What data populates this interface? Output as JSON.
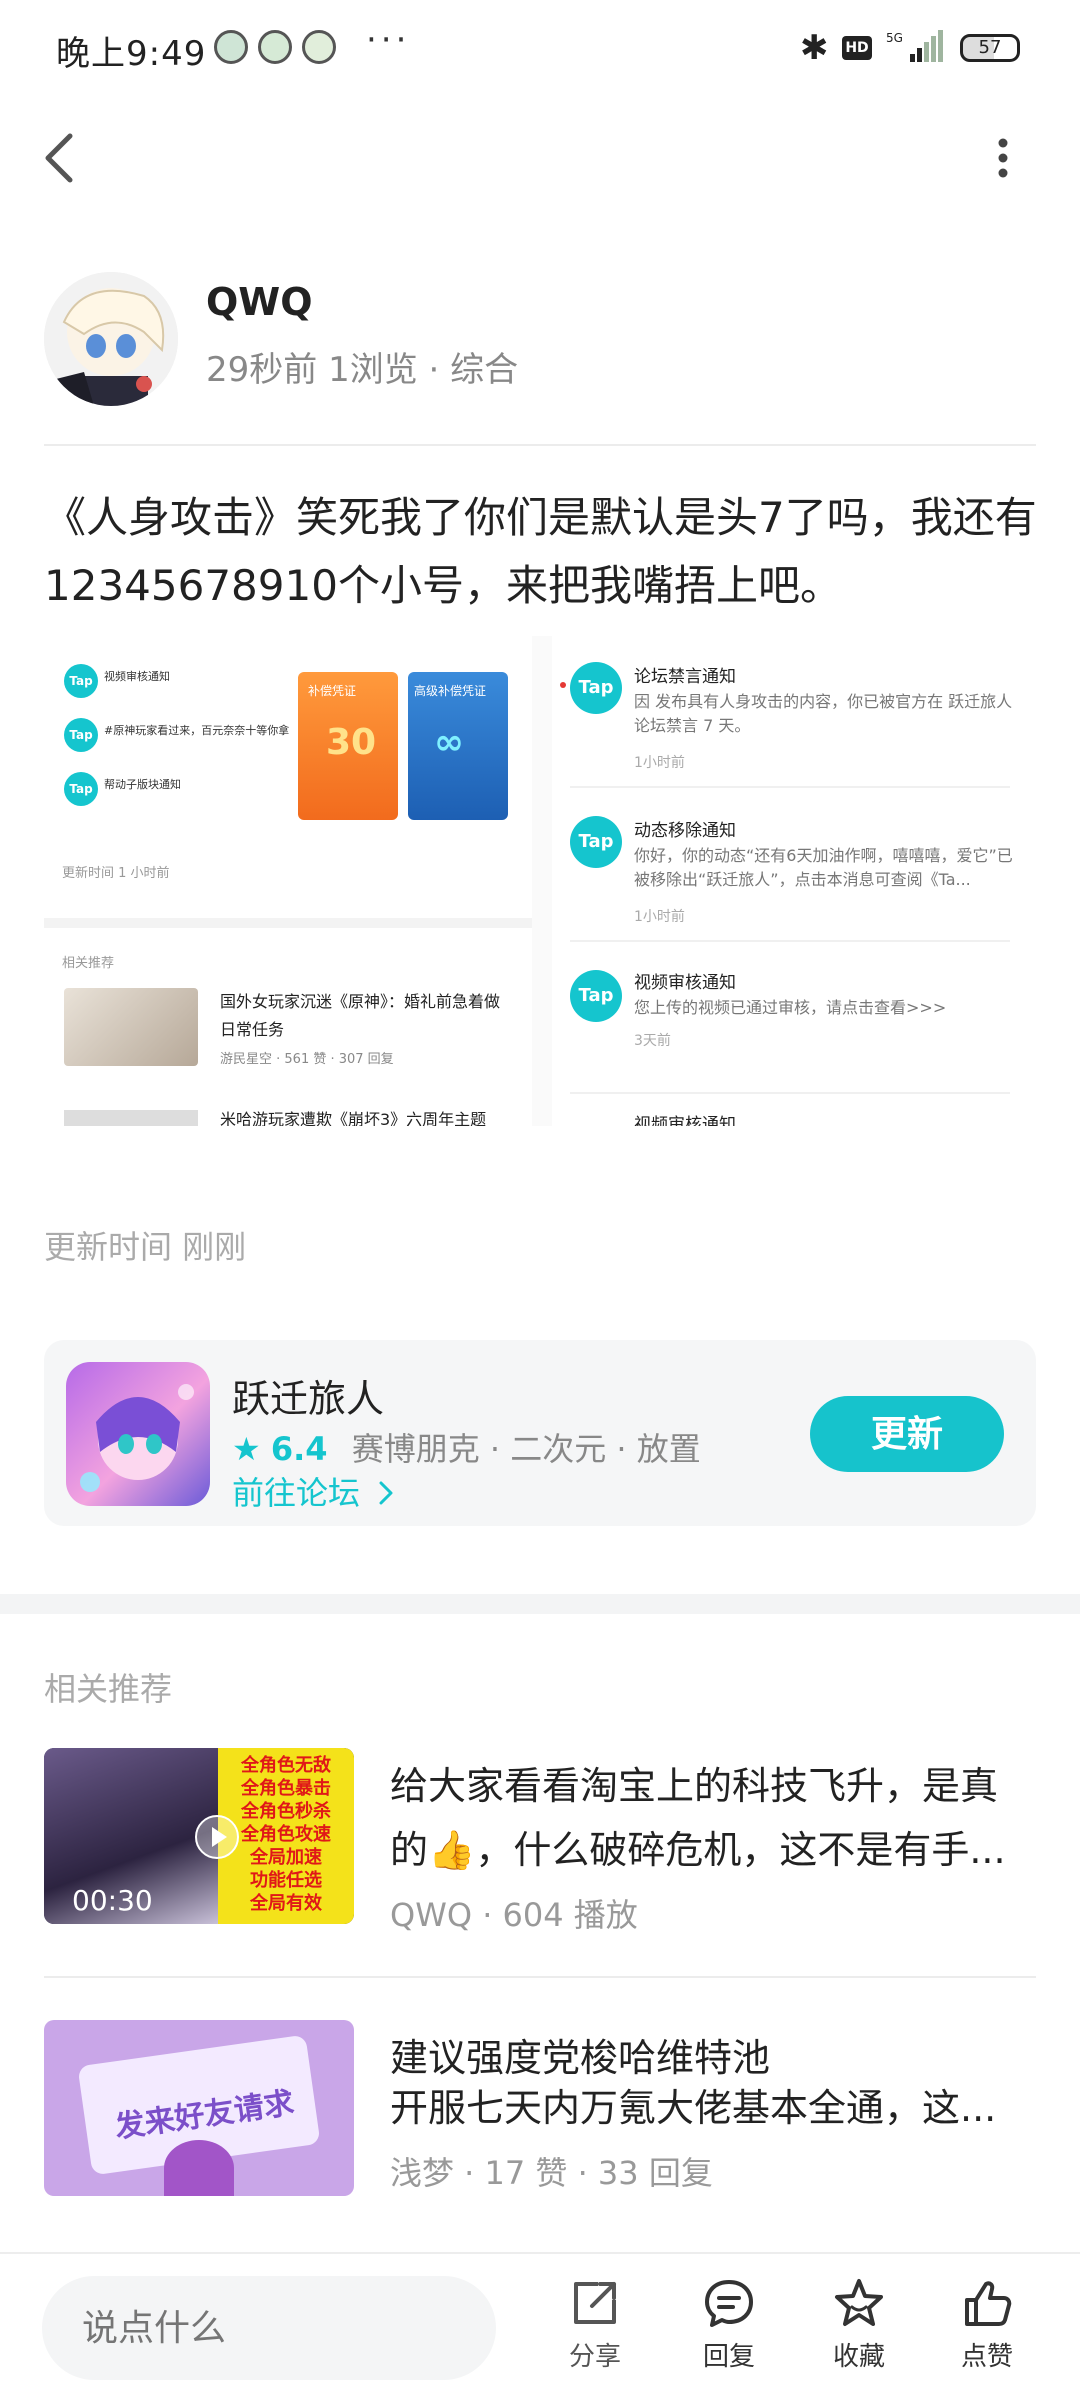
{
  "status_bar": {
    "time": "晚上9:49",
    "overflow": "···",
    "hd": "HD",
    "network": "5G",
    "battery": "57"
  },
  "author": {
    "name": "QWQ",
    "meta": "29秒前  1浏览  ·  综合"
  },
  "post": {
    "text": "《人身攻击》笑死我了你们是默认是头7了吗，我还有12345678910个小号，来把我嘴捂上吧。",
    "update_time": "更新时间 刚刚"
  },
  "screenshot": {
    "left": {
      "notices": [
        "视频审核通知",
        "#原神玩家看过来，百元奈奈十等你拿",
        "帮动子版块通知"
      ],
      "update_time": "更新时间 1 小时前",
      "rec_label": "相关推荐",
      "rec_item_title": "国外女玩家沉迷《原神》：婚礼前急着做日常任务",
      "rec_item_meta": "游民星空 · 561 赞 · 307 回复",
      "rec_item_title2": "米哈游玩家遭欺《崩坏3》六周年主题",
      "card1_label": "补偿凭证",
      "card2_label": "高级补偿凭证"
    },
    "right": {
      "items": [
        {
          "title": "论坛禁言通知",
          "body": "因 发布具有人身攻击的内容，你已被官方在 跃迁旅人 论坛禁言 7 天。",
          "time": "1小时前"
        },
        {
          "title": "动态移除通知",
          "body": "你好，你的动态“还有6天加油作啊，嘻嘻嘻，爱它”已被移除出“跃迁旅人”，点击本消息可查阅《Ta...",
          "time": "1小时前"
        },
        {
          "title": "视频审核通知",
          "body": "您上传的视频已通过审核，请点击查看>>>",
          "time": "3天前"
        },
        {
          "title": "视频审核通知",
          "body": "",
          "time": ""
        }
      ],
      "badge": "Tap"
    }
  },
  "game": {
    "name": "跃迁旅人",
    "rating": "6.4",
    "tags": "赛博朋克  ·  二次元  ·  放置",
    "link": "前往论坛",
    "button": "更新"
  },
  "recommend": {
    "title": "相关推荐",
    "items": [
      {
        "line1": "给大家看看淘宝上的科技飞升，是真",
        "line2": "的👍，什么破碎危机，这不是有手...",
        "meta": "QWQ  ·  604 播放",
        "duration": "00:30",
        "thumb_lines": [
          "全角色无敌",
          "全角色暴击",
          "全角色秒杀",
          "全角色攻速",
          "全局加速",
          "功能任选",
          "全局有效"
        ]
      },
      {
        "line1": "建议强度党梭哈维特池",
        "line2": "开服七天内万氪大佬基本全通，这...",
        "meta": "浅梦  ·  17 赞  ·  33 回复",
        "thumb_text": "发来好友请求"
      }
    ]
  },
  "bottom_bar": {
    "placeholder": "说点什么",
    "share": "分享",
    "reply": "回复",
    "favorite": "收藏",
    "like": "点赞"
  },
  "colors": {
    "accent": "#16c3cc",
    "text": "#222222",
    "muted": "#999999"
  }
}
